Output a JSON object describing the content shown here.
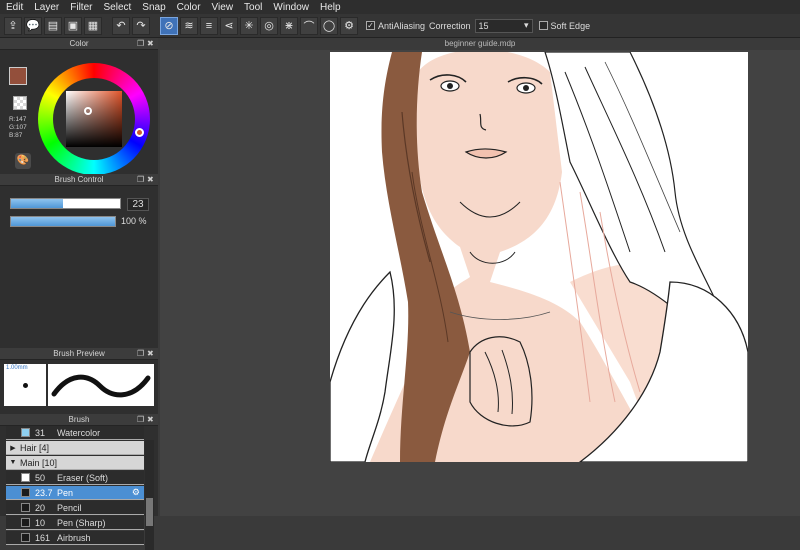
{
  "menu": [
    "Edit",
    "Layer",
    "Filter",
    "Select",
    "Snap",
    "Color",
    "View",
    "Tool",
    "Window",
    "Help"
  ],
  "toolbar": {
    "antialiasing_label": "AntiAliasing",
    "correction_label": "Correction",
    "correction_value": "15",
    "soft_edge_label": "Soft Edge"
  },
  "color_panel": {
    "title": "Color",
    "rgb": [
      "R:147",
      "G:107",
      "B:87"
    ],
    "foreground_color": "#934f3b"
  },
  "brush_control": {
    "title": "Brush Control",
    "size_value": "23",
    "size_fraction": 0.48,
    "opacity_value": "100 %",
    "opacity_fraction": 1.0
  },
  "brush_preview": {
    "title": "Brush Preview",
    "size_text": "1.00mm"
  },
  "brush_panel": {
    "title": "Brush",
    "items": [
      {
        "num": "31",
        "name": "Watercolor",
        "swatch": "#8fd0f0",
        "style": "dark"
      },
      {
        "group": "Hair [4]",
        "arrow": "▶"
      },
      {
        "group": "Main [10]",
        "arrow": "▼"
      },
      {
        "num": "50",
        "name": "Eraser (Soft)",
        "swatch": "#ffffff",
        "style": "dark"
      },
      {
        "num": "23.7",
        "name": "Pen",
        "swatch": "#1b1b1b",
        "style": "sel"
      },
      {
        "num": "20",
        "name": "Pencil",
        "swatch": "#1b1b1b",
        "style": "dark"
      },
      {
        "num": "10",
        "name": "Pen (Sharp)",
        "swatch": "#1b1b1b",
        "style": "dark"
      },
      {
        "num": "161",
        "name": "Airbrush",
        "swatch": "#1b1b1b",
        "style": "dark"
      }
    ]
  },
  "document": {
    "tab_title": "beginner guide.mdp"
  }
}
